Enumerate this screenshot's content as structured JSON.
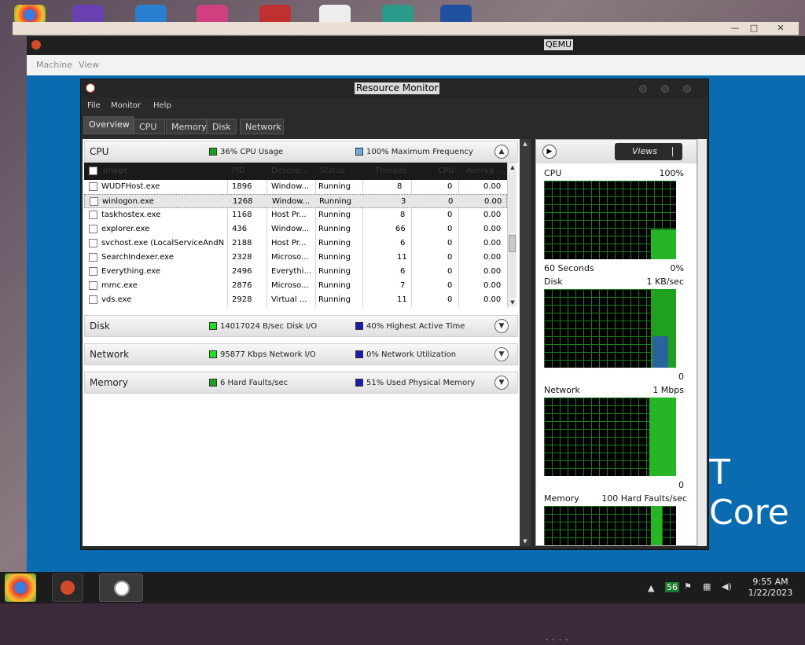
{
  "qemu": {
    "title": "QEMU",
    "menu": [
      "Machine",
      "View"
    ]
  },
  "host_controls": {
    "minimize": "—",
    "maximize": "□",
    "close": "✕"
  },
  "guest_background_text": "T Core",
  "resmon": {
    "title": "Resource Monitor",
    "menu": [
      "File",
      "Monitor",
      "Help"
    ],
    "tabs": [
      "Overview",
      "CPU",
      "Memory",
      "Disk",
      "Network"
    ],
    "active_tab": "Overview",
    "sections": {
      "cpu": {
        "name": "CPU",
        "metric1": "36% CPU Usage",
        "metric2": "100% Maximum Frequency",
        "metric1_color": "#1aa01a",
        "metric2_color": "#6fa8dc"
      },
      "disk": {
        "name": "Disk",
        "metric1": "14017024 B/sec Disk I/O",
        "metric2": "40% Highest Active Time",
        "metric1_color": "#22e022",
        "metric2_color": "#1a1ab0"
      },
      "network": {
        "name": "Network",
        "metric1": "95877 Kbps Network I/O",
        "metric2": "0% Network Utilization",
        "metric1_color": "#22e022",
        "metric2_color": "#1a1ab0"
      },
      "memory": {
        "name": "Memory",
        "metric1": "6 Hard Faults/sec",
        "metric2": "51% Used Physical Memory",
        "metric1_color": "#1aa01a",
        "metric2_color": "#1a1ab0"
      }
    },
    "process_table": {
      "columns": [
        "Image",
        "PID",
        "Descrip...",
        "Status",
        "Threads",
        "CPU",
        "Averag..."
      ],
      "rows": [
        [
          "WUDFHost.exe",
          "1896",
          "Window...",
          "Running",
          "8",
          "0",
          "0.00"
        ],
        [
          "winlogon.exe",
          "1268",
          "Window...",
          "Running",
          "3",
          "0",
          "0.00"
        ],
        [
          "taskhostex.exe",
          "1168",
          "Host Pr...",
          "Running",
          "8",
          "0",
          "0.00"
        ],
        [
          "explorer.exe",
          "436",
          "Window...",
          "Running",
          "66",
          "0",
          "0.00"
        ],
        [
          "svchost.exe (LocalServiceAndN...",
          "2188",
          "Host Pr...",
          "Running",
          "6",
          "0",
          "0.00"
        ],
        [
          "SearchIndexer.exe",
          "2328",
          "Microso...",
          "Running",
          "11",
          "0",
          "0.00"
        ],
        [
          "Everything.exe",
          "2496",
          "Everythi...",
          "Running",
          "6",
          "0",
          "0.00"
        ],
        [
          "mmc.exe",
          "2876",
          "Microso...",
          "Running",
          "7",
          "0",
          "0.00"
        ],
        [
          "vds.exe",
          "2928",
          "Virtual ...",
          "Running",
          "11",
          "0",
          "0.00"
        ]
      ],
      "selected_row": 1
    },
    "right_pane": {
      "views_label": "Views",
      "graphs": [
        {
          "name": "CPU",
          "max_label": "100%",
          "bottom_left": "60 Seconds",
          "bottom_right": "0%"
        },
        {
          "name": "Disk",
          "max_label": "1 KB/sec",
          "bottom_left": "",
          "bottom_right": "0"
        },
        {
          "name": "Network",
          "max_label": "1 Mbps",
          "bottom_left": "",
          "bottom_right": "0"
        },
        {
          "name": "Memory",
          "max_label": "100 Hard Faults/sec",
          "bottom_left": "",
          "bottom_right": ""
        }
      ]
    }
  },
  "taskbar": {
    "tray_badge": "56",
    "time": "9:55 AM",
    "date": "1/22/2023"
  }
}
